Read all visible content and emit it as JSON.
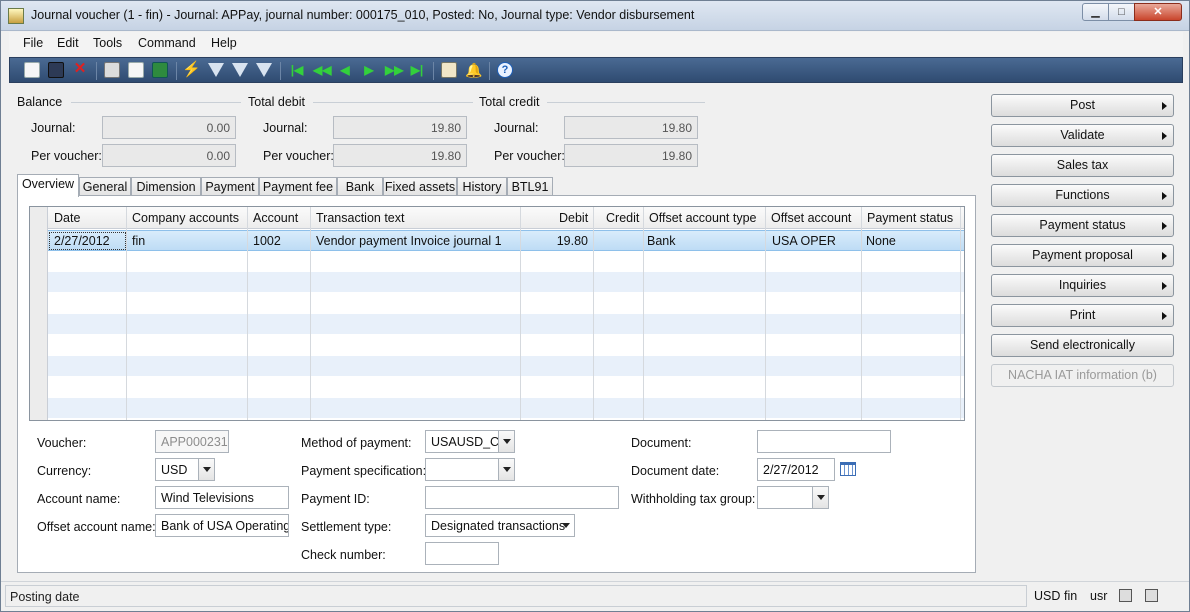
{
  "window": {
    "title": "Journal voucher (1 - fin) - Journal: APPay, journal number: 000175_010, Posted: No, Journal type: Vendor disbursement",
    "min_label": "▁",
    "max_label": "□",
    "close_label": "✕"
  },
  "menu": [
    "File",
    "Edit",
    "Tools",
    "Command",
    "Help"
  ],
  "toolbar_icons": [
    "new-icon",
    "save-icon",
    "delete-icon",
    "print-icon",
    "print-preview-icon",
    "export-excel-icon",
    "filter-by-selection-icon",
    "filter-by-grid-icon",
    "advanced-filter-icon",
    "remove-filter-icon",
    "first-record-icon",
    "previous-page-icon",
    "previous-record-icon",
    "next-record-icon",
    "next-page-icon",
    "last-record-icon",
    "attachment-icon",
    "alert-icon",
    "help-icon"
  ],
  "totals": {
    "balance": {
      "title": "Balance",
      "journal_label": "Journal:",
      "journal": "0.00",
      "voucher_label": "Per voucher:",
      "voucher": "0.00"
    },
    "debit": {
      "title": "Total debit",
      "journal_label": "Journal:",
      "journal": "19.80",
      "voucher_label": "Per voucher:",
      "voucher": "19.80"
    },
    "credit": {
      "title": "Total credit",
      "journal_label": "Journal:",
      "journal": "19.80",
      "voucher_label": "Per voucher:",
      "voucher": "19.80"
    }
  },
  "tabs": [
    "Overview",
    "General",
    "Dimension",
    "Payment",
    "Payment fee",
    "Bank",
    "Fixed assets",
    "History",
    "BTL91"
  ],
  "grid": {
    "columns": [
      "Date",
      "Company accounts",
      "Account",
      "Transaction text",
      "Debit",
      "Credit",
      "Offset account type",
      "Offset account",
      "Payment status"
    ],
    "rows": [
      [
        "2/27/2012",
        "fin",
        "1002",
        "Vendor payment Invoice journal 1",
        "19.80",
        "",
        "Bank",
        "USA OPER",
        "None"
      ]
    ]
  },
  "form": {
    "voucher_label": "Voucher:",
    "voucher": "APP000231",
    "currency_label": "Currency:",
    "currency": "USD",
    "account_name_label": "Account name:",
    "account_name": "Wind Televisions",
    "offset_account_name_label": "Offset account name:",
    "offset_account_name": "Bank of USA Operating",
    "method_label": "Method of payment:",
    "method": "USAUSD_CH",
    "payment_spec_label": "Payment specification:",
    "payment_spec": "",
    "payment_id_label": "Payment ID:",
    "payment_id": "",
    "settlement_label": "Settlement type:",
    "settlement": "Designated transactions",
    "check_number_label": "Check number:",
    "check_number": "",
    "document_label": "Document:",
    "document": "",
    "document_date_label": "Document date:",
    "document_date": "2/27/2012",
    "withholding_label": "Withholding tax group:",
    "withholding": ""
  },
  "actions": [
    {
      "label": "Post",
      "submenu": true,
      "enabled": true
    },
    {
      "label": "Validate",
      "submenu": true,
      "enabled": true
    },
    {
      "label": "Sales tax",
      "submenu": false,
      "enabled": true
    },
    {
      "label": "Functions",
      "submenu": true,
      "enabled": true
    },
    {
      "label": "Payment status",
      "submenu": true,
      "enabled": true
    },
    {
      "label": "Payment proposal",
      "submenu": true,
      "enabled": true
    },
    {
      "label": "Inquiries",
      "submenu": true,
      "enabled": true
    },
    {
      "label": "Print",
      "submenu": true,
      "enabled": true
    },
    {
      "label": "Send electronically",
      "submenu": false,
      "enabled": true
    },
    {
      "label": "NACHA IAT information (b)",
      "submenu": false,
      "enabled": false
    }
  ],
  "status": {
    "text": "Posting date",
    "currency": "USD",
    "company": "fin",
    "user": "usr"
  }
}
